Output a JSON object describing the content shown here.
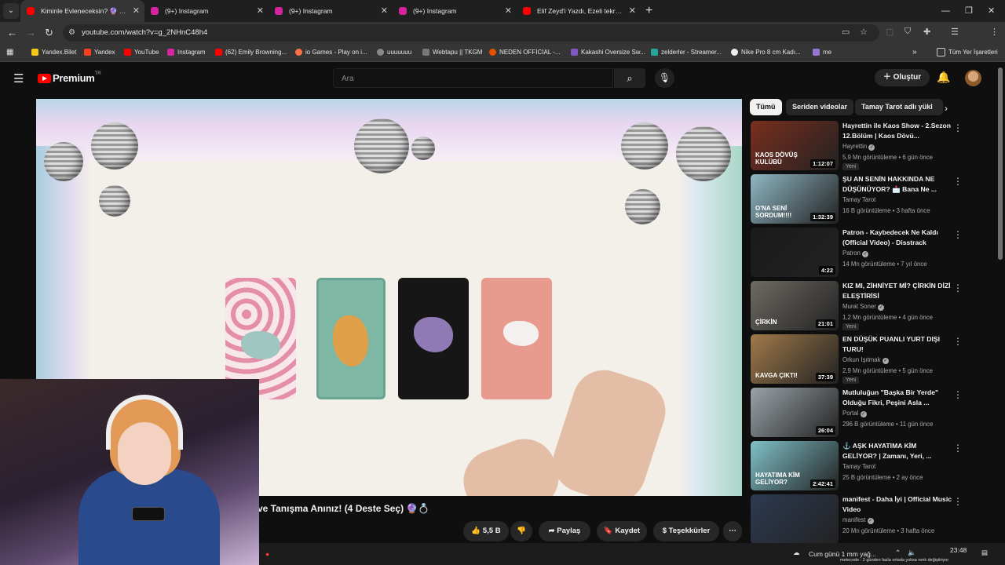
{
  "browser": {
    "tabs": [
      {
        "title": "Kiminle Evleneceksin? 🔮 Adı, B",
        "active": true,
        "favicon_color": "#ff0000"
      },
      {
        "title": "(9+) Instagram",
        "active": false,
        "favicon_color": "#d6249f"
      },
      {
        "title": "(9+) Instagram",
        "active": false,
        "favicon_color": "#d6249f"
      },
      {
        "title": "(9+) Instagram",
        "active": false,
        "favicon_color": "#d6249f"
      },
      {
        "title": "Elif Zeyd'i Yazdı, Ezeli tekrardan",
        "active": false,
        "favicon_color": "#ff0000"
      }
    ],
    "url": "youtube.com/watch?v=g_2NHnC48h4",
    "profile_initial": "Z",
    "bookmarks": [
      "Yandex.Bilet",
      "Yandex",
      "YouTube",
      "Instagram",
      "(62) Emily Browning...",
      "io Games - Play on i...",
      "uuuuuuu",
      "Webtapu || TKGM",
      "NEDEN OFFICIAL -...",
      "Kakashi Oversize Sw...",
      "zelderler - Streamer...",
      "Nike Pro 8 cm Kadı...",
      "me"
    ],
    "all_bookmarks": "Tüm Yer İşaretleri"
  },
  "youtube": {
    "logo_text": "Premium",
    "logo_suffix": "TR",
    "search_placeholder": "Ara",
    "create_label": "Oluştur",
    "video_title_visible": "ve Tanışma Anınız! (4 Deste Seç) 🔮💍",
    "actions": {
      "likes": "5,5 B",
      "share": "Paylaş",
      "save": "Kaydet",
      "thanks": "Teşekkürler"
    },
    "chips": [
      "Tümü",
      "Seriden videolar",
      "Tamay Tarot adlı yükl"
    ],
    "recommendations": [
      {
        "title": "Hayrettin ile Kaos Show - 2.Sezon 12.Bölüm | Kaos Dövü...",
        "channel": "Hayrettin",
        "verified": true,
        "meta": "5,9 Mn görüntüleme • 6 gün önce",
        "badge": "Yeni",
        "duration": "1:12:07",
        "thumb_text": "KAOS DÖVÜŞ KULÜBÜ",
        "thumb_color": "#7a2e1e"
      },
      {
        "title": "ŞU AN SENİN HAKKINDA NE DÜŞÜNÜYOR? 📩 Bana Ne ...",
        "channel": "Tamay Tarot",
        "verified": false,
        "meta": "16 B görüntüleme • 3 hafta önce",
        "badge": "",
        "duration": "1:32:39",
        "thumb_text": "O'NA SENİ SORDUM!!!!",
        "thumb_color": "#8fb7c4"
      },
      {
        "title": "Patron - Kaybedecek Ne Kaldı (Official Video) - Disstrack",
        "channel": "Patron",
        "verified": true,
        "meta": "14 Mn görüntüleme • 7 yıl önce",
        "badge": "",
        "duration": "4:22",
        "thumb_text": "",
        "thumb_color": "#1a1a1a"
      },
      {
        "title": "KIZ MI, ZİHNİYET Mİ? ÇİRKİN DİZİ ELEŞTİRİSİ",
        "channel": "Murat Soner",
        "verified": true,
        "meta": "1,2 Mn görüntüleme • 4 gün önce",
        "badge": "Yeni",
        "duration": "21:01",
        "thumb_text": "ÇİRKİN",
        "thumb_color": "#6e6a63"
      },
      {
        "title": "EN DÜŞÜK PUANLI YURT DIŞI TURU!",
        "channel": "Orkun Işıtmak",
        "verified": true,
        "meta": "2,9 Mn görüntüleme • 5 gün önce",
        "badge": "Yeni",
        "duration": "37:39",
        "thumb_text": "KAVGA ÇIKTI!",
        "thumb_color": "#a07a4a"
      },
      {
        "title": "Mutluluğun \"Başka Bir Yerde\" Olduğu Fikri, Peşini Asla ...",
        "channel": "Portal",
        "verified": true,
        "meta": "296 B görüntüleme • 11 gün önce",
        "badge": "",
        "duration": "26:04",
        "thumb_text": "",
        "thumb_color": "#9aa3a8"
      },
      {
        "title": "⚓ AŞK HAYATIMA KİM GELİYOR? | Zamanı, Yeri, ...",
        "channel": "Tamay Tarot",
        "verified": false,
        "meta": "25 B görüntüleme • 2 ay önce",
        "badge": "",
        "duration": "2:42:41",
        "thumb_text": "HAYATIMA KİM GELİYOR?",
        "thumb_color": "#7fc1c9"
      },
      {
        "title": "manifest - Daha İyi | Official Music Video",
        "channel": "manifest",
        "verified": true,
        "meta": "20 Mn görüntüleme • 3 hafta önce",
        "badge": "",
        "duration": "",
        "thumb_text": "",
        "thumb_color": "#2d3a52"
      }
    ]
  },
  "taskbar": {
    "weather": "Cum günü 1 mm yağ...",
    "time": "23:48",
    "date": "29.04.2026",
    "ticker": "metecode : 2 günden fazla ortada yoksa renk değiştiriyor"
  }
}
